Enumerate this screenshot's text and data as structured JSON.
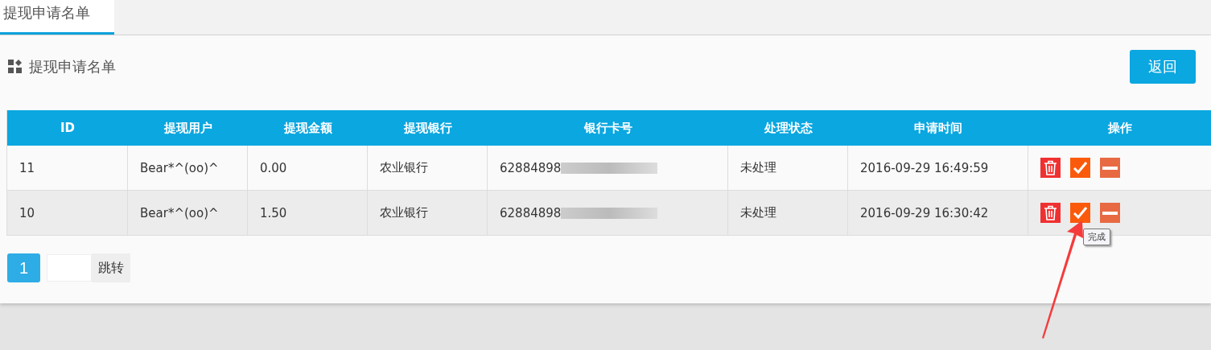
{
  "tabs": [
    {
      "label": "提现申请名单",
      "selected": true
    }
  ],
  "panel": {
    "title": "提现申请名单",
    "back_button": "返回"
  },
  "table": {
    "columns": [
      "ID",
      "提现用户",
      "提现金额",
      "提现银行",
      "银行卡号",
      "处理状态",
      "申请时间",
      "操作"
    ],
    "rows": [
      {
        "id": "11",
        "user": "Bear*^(oo)^",
        "amount": "0.00",
        "bank": "农业银行",
        "card": "62884898",
        "status": "未处理",
        "time": "2016-09-29 16:49:59",
        "selected": false
      },
      {
        "id": "10",
        "user": "Bear*^(oo)^",
        "amount": "1.50",
        "bank": "农业银行",
        "card": "62884898",
        "status": "未处理",
        "time": "2016-09-29 16:30:42",
        "selected": true
      }
    ]
  },
  "tooltip": "完成",
  "pagination": {
    "pages": [
      {
        "label": "1",
        "selected": true
      }
    ],
    "jump_button": "跳转"
  }
}
